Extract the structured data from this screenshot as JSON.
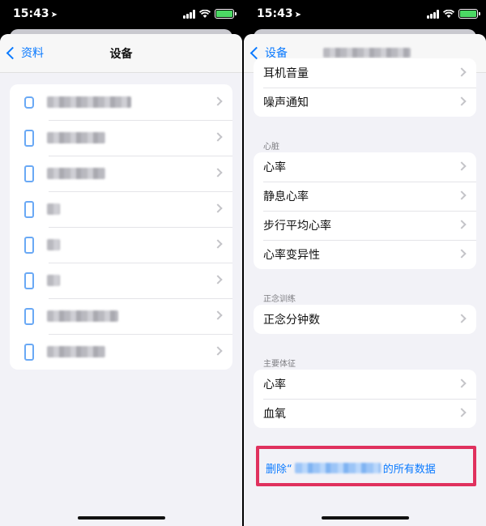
{
  "status_bar": {
    "time": "15:43"
  },
  "left": {
    "nav": {
      "back_label": "资料",
      "title": "设备"
    },
    "devices": [
      {
        "icon": "watch-icon"
      },
      {
        "icon": "phone-icon"
      },
      {
        "icon": "phone-icon"
      },
      {
        "icon": "phone-icon"
      },
      {
        "icon": "phone-icon"
      },
      {
        "icon": "phone-icon"
      },
      {
        "icon": "phone-icon"
      },
      {
        "icon": "phone-icon"
      }
    ]
  },
  "right": {
    "nav": {
      "back_label": "设备"
    },
    "top_rows": [
      "耳机音量",
      "噪声通知"
    ],
    "sections": [
      {
        "title": "心脏",
        "rows": [
          "心率",
          "静息心率",
          "步行平均心率",
          "心率变异性"
        ]
      },
      {
        "title": "正念训练",
        "rows": [
          "正念分钟数"
        ]
      },
      {
        "title": "主要体征",
        "rows": [
          "心率",
          "血氧"
        ]
      }
    ],
    "delete": {
      "prefix": "删除“",
      "suffix": "的所有数据"
    }
  },
  "colors": {
    "accent": "#0a7aff",
    "highlight": "#e0315e",
    "background": "#f2f2f7"
  }
}
